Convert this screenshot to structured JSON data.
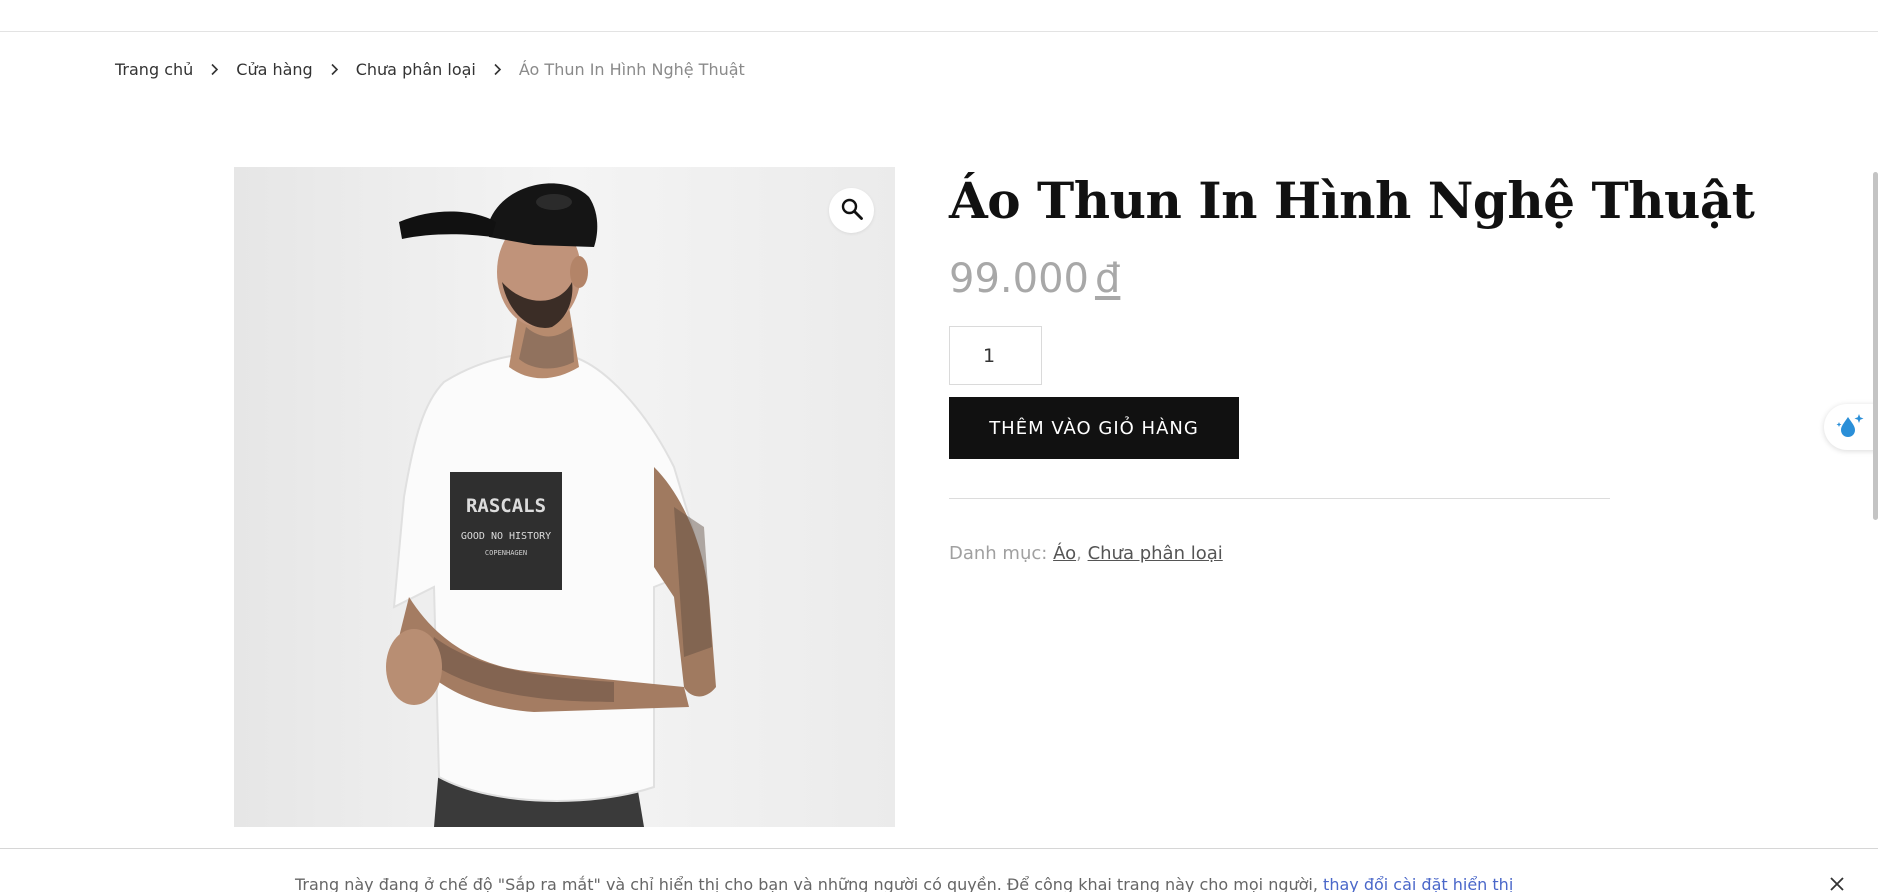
{
  "breadcrumb": {
    "items": [
      "Trang chủ",
      "Cửa hàng",
      "Chưa phân loại"
    ],
    "current": "Áo Thun In Hình Nghệ Thuật",
    "separator_icon": "chevron-right-icon"
  },
  "product": {
    "title": "Áo Thun In Hình Nghệ Thuật",
    "price": "99.000",
    "currency": "đ",
    "quantity": "1",
    "add_to_cart_label": "THÊM VÀO GIỎ HÀNG",
    "image_print_text": [
      "RASCALS",
      "GOOD NO HISTORY",
      "COPENHAGEN"
    ],
    "zoom_icon": "magnifier-icon"
  },
  "meta": {
    "category_label": "Danh mục:",
    "categories": [
      "Áo",
      "Chưa phân loại"
    ],
    "category_separator": ","
  },
  "side_widget": {
    "icon": "water-drop-sparkle-icon"
  },
  "notice": {
    "text": "Trang này đang ở chế độ \"Sắp ra mắt\" và chỉ hiển thị cho bạn và những người có quyền. Để công khai trang này cho mọi người,",
    "link": "thay đổi cài đặt hiển thị",
    "close_icon": "close-icon"
  },
  "colors": {
    "button_bg": "#111111",
    "price": "#a8a8a8",
    "link": "#4a67c9",
    "image_bg": "#efefef"
  }
}
